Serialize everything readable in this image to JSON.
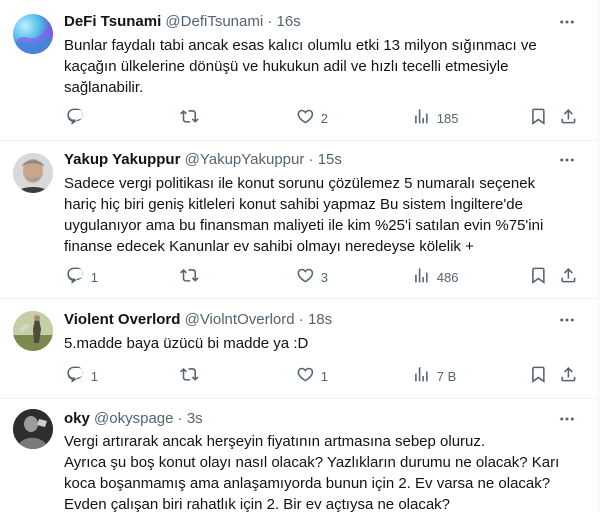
{
  "tweets": [
    {
      "name": "DeFi Tsunami",
      "handle": "@DefiTsunami",
      "time": "16s",
      "lines": [
        "Bunlar faydalı tabi ancak esas kalıcı olumlu etki 13 milyon sığınmacı ve",
        "kaçağın ülkelerine dönüşü ve hukukun adil ve hızlı tecelli etmesiyle",
        "sağlanabilir."
      ],
      "replies": "",
      "retweets": "",
      "likes": "2",
      "views": "185"
    },
    {
      "name": "Yakup Yakuppur",
      "handle": "@YakupYakuppur",
      "time": "15s",
      "lines": [
        "Sadece vergi politikası ile konut sorunu çözülemez 5 numaralı seçenek",
        "hariç hiç biri geniş kitleleri konut sahibi yapmaz Bu sistem İngiltere'de",
        "uygulanıyor ama bu finansman maliyeti ile kim %25'i satılan evin %75'ini",
        "finanse edecek Kanunlar ev sahibi olmayı neredeyse kölelik +"
      ],
      "replies": "1",
      "retweets": "",
      "likes": "3",
      "views": "486"
    },
    {
      "name": "Violent Overlord",
      "handle": "@ViolntOverlord",
      "time": "18s",
      "lines": [
        "5.madde baya üzücü bi madde ya :D"
      ],
      "replies": "1",
      "retweets": "",
      "likes": "1",
      "views": "7 B"
    },
    {
      "name": "oky",
      "handle": "@okyspage",
      "time": "3s",
      "lines": [
        "Vergi artırarak ancak herşeyin fiyatının artmasına sebep oluruz.",
        "Ayrıca şu boş konut olayı nasıl olacak? Yazlıkların durumu ne olacak? Karı",
        "koca boşanmamış ama anlaşamıyorda bunun için 2. Ev varsa ne olacak?",
        "Evden çalışan biri rahatlık için 2. Bir ev açtıysa ne olacak?"
      ]
    }
  ],
  "separator": "·",
  "icons": {
    "reply": "reply-icon",
    "retweet": "retweet-icon",
    "like": "heart-icon",
    "views": "views-icon",
    "bookmark": "bookmark-icon",
    "share": "share-icon",
    "more": "more-icon"
  },
  "colors": {
    "text": "#0f1419",
    "secondary": "#536471",
    "border": "#eff3f4"
  }
}
